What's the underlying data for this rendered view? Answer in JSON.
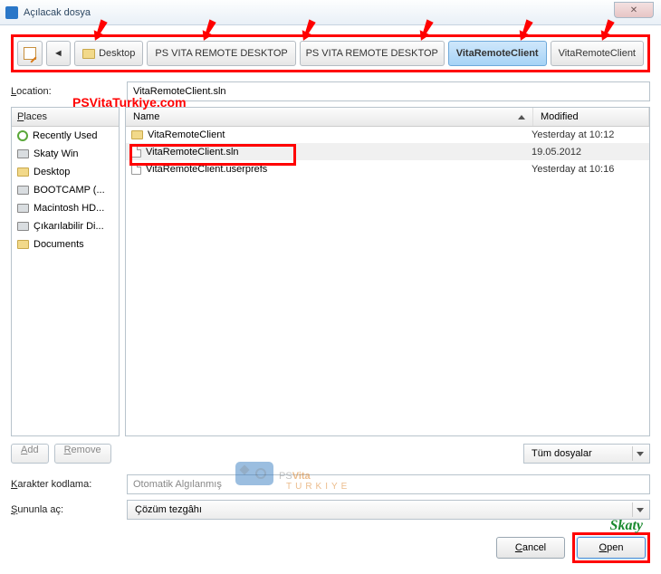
{
  "window": {
    "title": "Açılacak dosya"
  },
  "toolbar": {
    "edit_tooltip": "Edit path",
    "back_arrow": "◄",
    "crumbs": [
      {
        "label": "Desktop",
        "selected": false,
        "has_icon": true
      },
      {
        "label": "PS VITA REMOTE DESKTOP",
        "selected": false
      },
      {
        "label": "PS VITA REMOTE DESKTOP",
        "selected": false
      },
      {
        "label": "VitaRemoteClient",
        "selected": true
      },
      {
        "label": "VitaRemoteClient",
        "selected": false
      }
    ]
  },
  "location": {
    "label": "Location:",
    "value": "VitaRemoteClient.sln"
  },
  "places": {
    "header": "Places",
    "items": [
      {
        "label": "Recently Used",
        "icon": "recent"
      },
      {
        "label": "Skaty Win",
        "icon": "drive"
      },
      {
        "label": "Desktop",
        "icon": "folder"
      },
      {
        "label": "BOOTCAMP (...",
        "icon": "drive"
      },
      {
        "label": "Macintosh HD...",
        "icon": "drive"
      },
      {
        "label": "Çıkarılabilir Di...",
        "icon": "drive"
      },
      {
        "label": "Documents",
        "icon": "folder"
      }
    ]
  },
  "filelist": {
    "columns": {
      "name": "Name",
      "modified": "Modified"
    },
    "rows": [
      {
        "name": "VitaRemoteClient",
        "type": "folder",
        "modified": "Yesterday at 10:12",
        "selected": false
      },
      {
        "name": "VitaRemoteClient.sln",
        "type": "file",
        "modified": "19.05.2012",
        "selected": true
      },
      {
        "name": "VitaRemoteClient.userprefs",
        "type": "file",
        "modified": "Yesterday at 10:16",
        "selected": false
      }
    ]
  },
  "buttons": {
    "add": "Add",
    "remove": "Remove",
    "filter": "Tüm dosyalar",
    "cancel": "Cancel",
    "open": "Open"
  },
  "encoding": {
    "label": "Karakter kodlama:",
    "value": "Otomatik Algılanmış"
  },
  "openwith": {
    "label": "Şununla aç:",
    "value": "Çözüm tezgâhı"
  },
  "watermarks": {
    "url": "PSVitaTurkiye.com",
    "logo_main": "PSVita",
    "logo_sub": "TURKIYE",
    "author": "Skaty"
  }
}
